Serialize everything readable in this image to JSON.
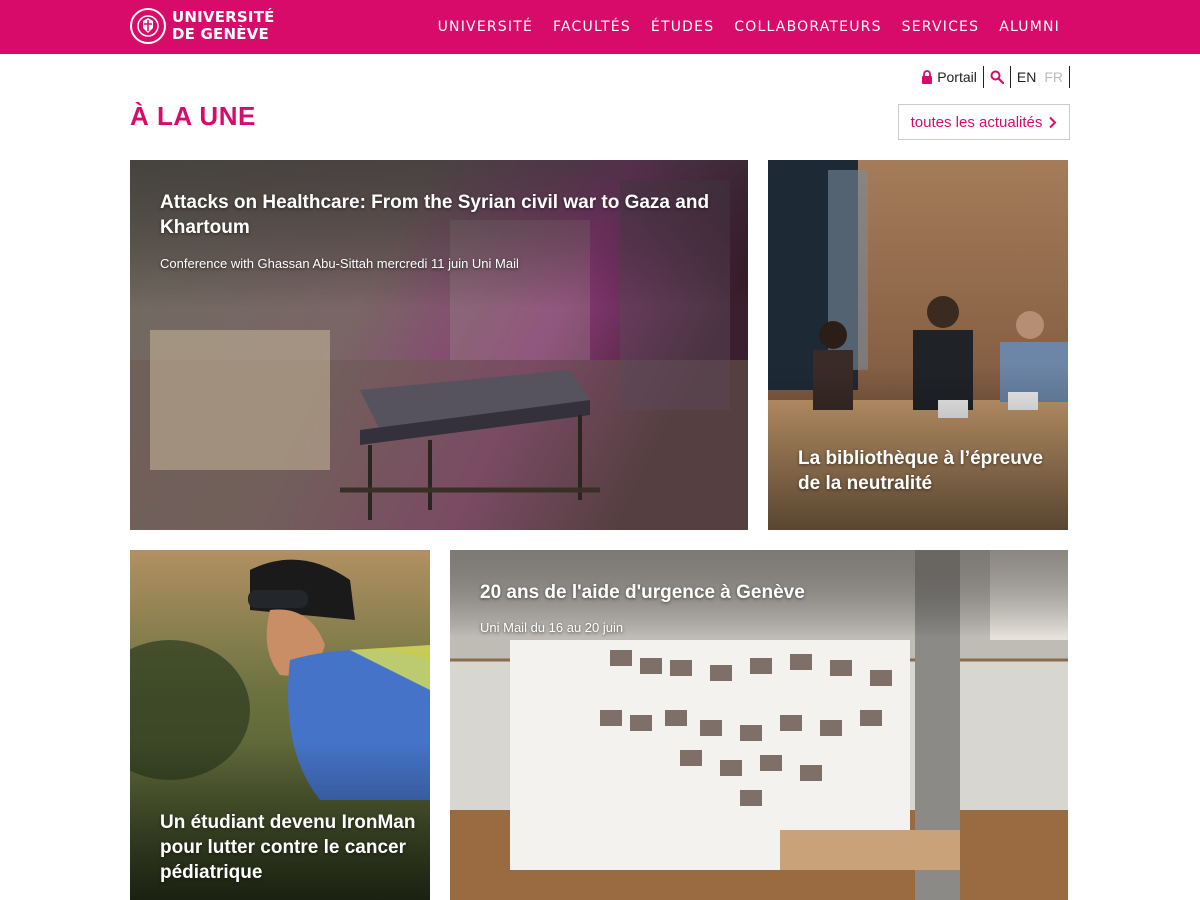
{
  "site": {
    "logo_line1": "UNIVERSITÉ",
    "logo_line2": "DE GENÈVE",
    "brand_color": "#d80b6b"
  },
  "nav": {
    "items": [
      {
        "label": "UNIVERSITÉ"
      },
      {
        "label": "FACULTÉS"
      },
      {
        "label": "ÉTUDES"
      },
      {
        "label": "COLLABORATEURS"
      },
      {
        "label": "SERVICES"
      },
      {
        "label": "ALUMNI"
      }
    ]
  },
  "utility": {
    "portal_label": "Portail",
    "portal_icon": "lock-icon",
    "search_icon": "search-icon",
    "lang_en": "EN",
    "lang_fr": "FR"
  },
  "section": {
    "title": "À LA UNE",
    "all_news_label": "toutes les actualités",
    "all_news_icon": "chevron-right-icon"
  },
  "cards": [
    {
      "title": "Attacks on Healthcare: From the Syrian civil war to Gaza and Khartoum",
      "subtitle": "Conference with Ghassan Abu-Sittah mercredi 11 juin Uni Mail"
    },
    {
      "title": "La bibliothèque à l’épreuve de la neutralité",
      "subtitle": ""
    },
    {
      "title": "Un étudiant devenu IronMan pour lutter contre le cancer pédiatrique",
      "subtitle": ""
    },
    {
      "title": "20 ans de l'aide d'urgence à Genève",
      "subtitle": "Uni Mail du 16 au 20 juin"
    }
  ]
}
